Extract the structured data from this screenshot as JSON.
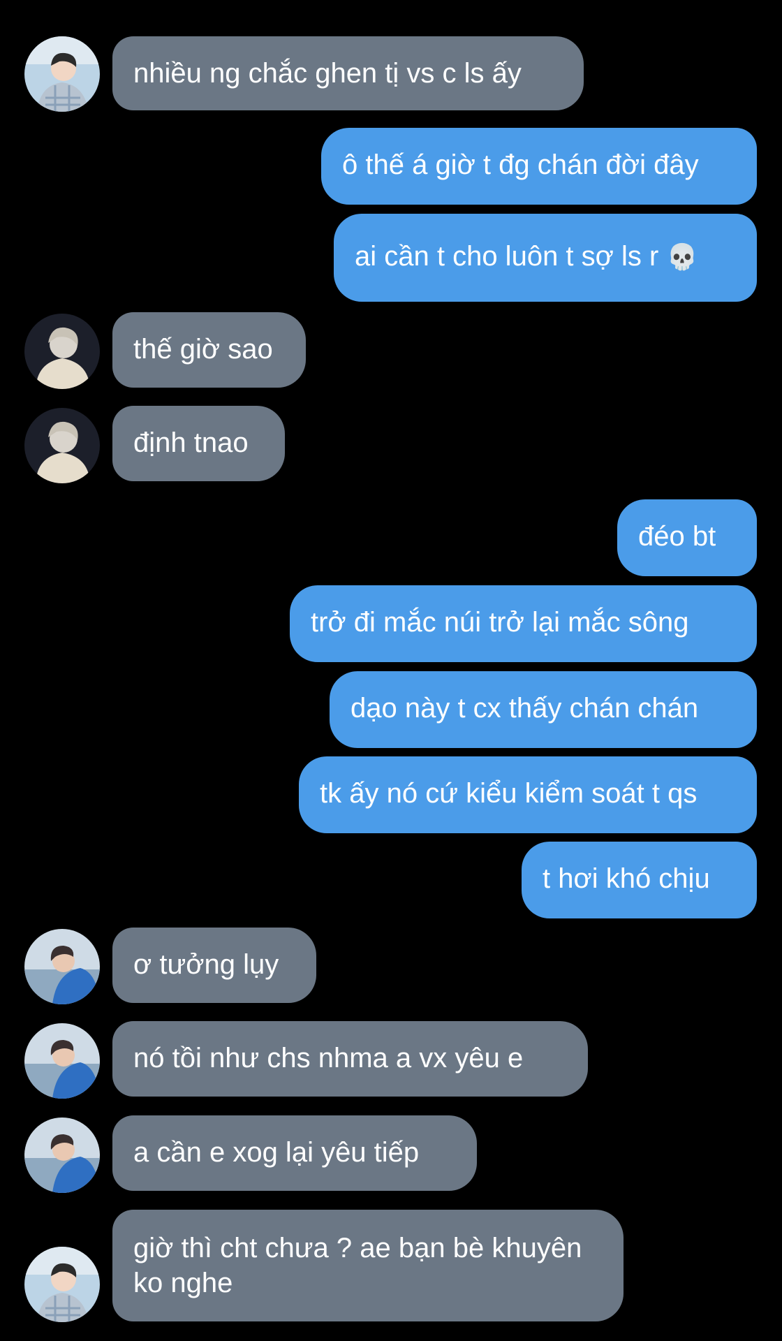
{
  "conversation": {
    "messages": [
      {
        "from": "them",
        "avatar": "avatar-boy-plaid",
        "text": "nhiều ng chắc ghen tị vs c ls ấy"
      },
      {
        "from": "me",
        "text": "ô thế á giờ t đg chán đời đây"
      },
      {
        "from": "me",
        "text": "ai cần t cho luôn t sợ ls r",
        "emoji": "💀"
      },
      {
        "from": "them",
        "avatar": "avatar-white-hood",
        "text": "thế giờ sao"
      },
      {
        "from": "them",
        "avatar": "avatar-white-hood",
        "text": "định tnao"
      },
      {
        "from": "me",
        "text": "đéo bt"
      },
      {
        "from": "me",
        "text": "trở đi mắc núi trở lại mắc sông"
      },
      {
        "from": "me",
        "text": "dạo này t cx thấy chán chán"
      },
      {
        "from": "me",
        "text": "tk ấy nó cứ kiểu kiểm soát t qs"
      },
      {
        "from": "me",
        "text": "t hơi khó chịu"
      },
      {
        "from": "them",
        "avatar": "avatar-boy-blue-sea",
        "text": "ơ tưởng lụy"
      },
      {
        "from": "them",
        "avatar": "avatar-boy-blue-sea",
        "text": "nó tồi như chs nhma a vx yêu e"
      },
      {
        "from": "them",
        "avatar": "avatar-boy-blue-sea",
        "text": "a cần e xog lại yêu tiếp"
      },
      {
        "from": "them",
        "avatar": "avatar-boy-plaid",
        "text": "giờ thì cht chưa ? ae bạn bè khuyên ko nghe"
      }
    ]
  },
  "colors": {
    "background": "#000000",
    "incoming_bubble": "#6b7785",
    "outgoing_bubble": "#4b9ce9",
    "text": "#ffffff"
  }
}
